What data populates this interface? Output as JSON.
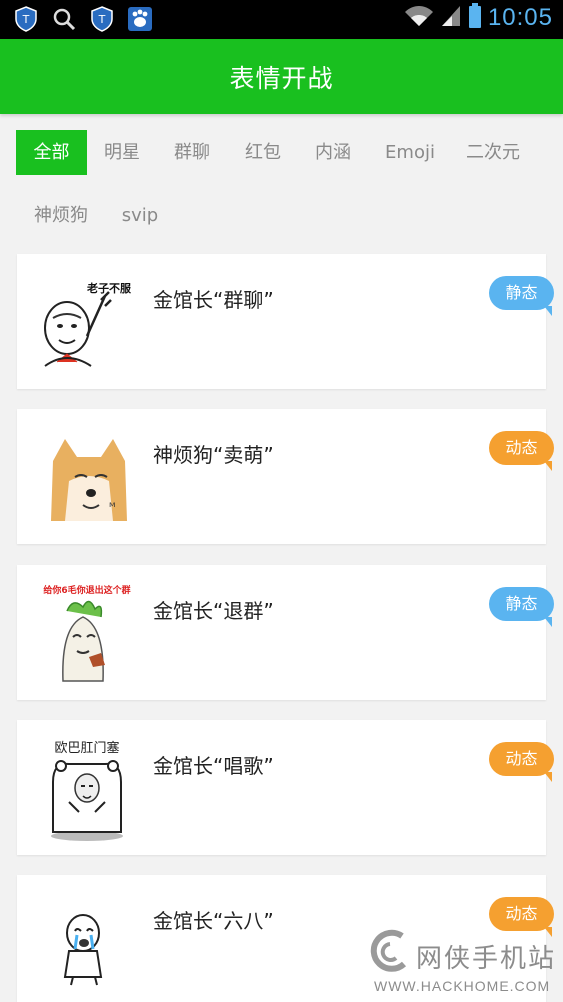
{
  "status_bar": {
    "time": "10:05",
    "icons": [
      "shield-app-icon",
      "search-icon",
      "shield-app-icon",
      "baidu-paw-icon",
      "wifi-icon",
      "signal-icon",
      "battery-icon"
    ]
  },
  "app_bar": {
    "title": "表情开战",
    "color": "#19c01f"
  },
  "tabs": [
    {
      "label": "全部",
      "active": true
    },
    {
      "label": "明星"
    },
    {
      "label": "群聊"
    },
    {
      "label": "红包"
    },
    {
      "label": "内涵"
    },
    {
      "label": "Emoji"
    },
    {
      "label": "二次元"
    },
    {
      "label": "神烦狗"
    },
    {
      "label": "svip"
    }
  ],
  "cards": [
    {
      "title": "金馆长“群聊”",
      "badge": "静态",
      "badge_type": "static",
      "caption": "老子不服",
      "thumb": "panda-man-pointing"
    },
    {
      "title": "神烦狗“卖萌”",
      "badge": "动态",
      "badge_type": "dynamic",
      "caption": "",
      "thumb": "doge"
    },
    {
      "title": "金馆长“退群”",
      "badge": "静态",
      "badge_type": "static",
      "caption": "给你6毛你退出这个群",
      "thumb": "radish-man"
    },
    {
      "title": "金馆长“唱歌”",
      "badge": "动态",
      "badge_type": "dynamic",
      "caption": "欧巴肛门塞",
      "thumb": "bear-man"
    },
    {
      "title": "金馆长“六八”",
      "badge": "动态",
      "badge_type": "dynamic",
      "caption": "",
      "thumb": "crying-man"
    }
  ],
  "watermark": {
    "cn": "网侠手机站",
    "en": "WWW.HACKHOME.COM"
  },
  "colors": {
    "static_badge": "#5ab4f0",
    "dynamic_badge": "#f5a030",
    "accent": "#19c01f"
  }
}
